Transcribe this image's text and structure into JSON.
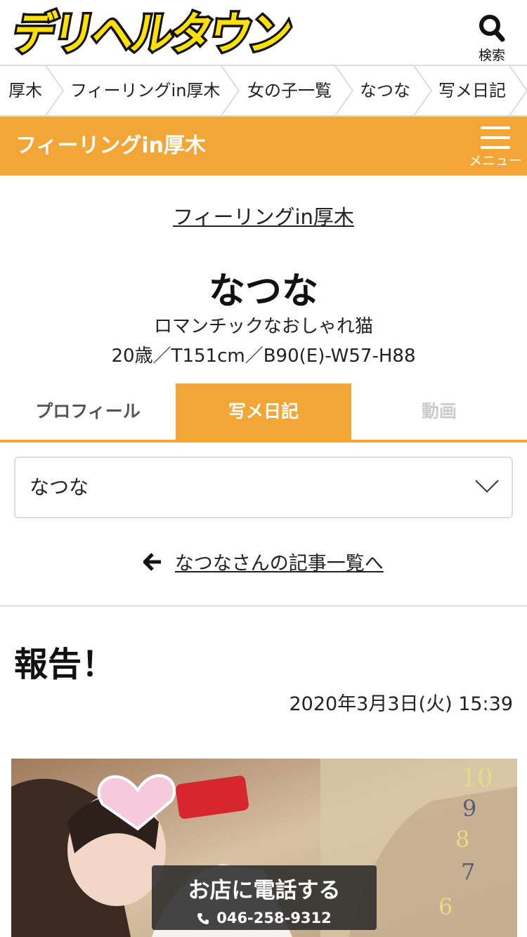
{
  "header": {
    "logo_text": "デリヘルタウン",
    "search_label": "検索"
  },
  "breadcrumb": [
    "厚木",
    "フィーリングin厚木",
    "女の子一覧",
    "なつな",
    "写メ日記"
  ],
  "shop_bar": {
    "title": "フィーリングin厚木",
    "menu_label": "メニュー"
  },
  "profile": {
    "shop_link": "フィーリングin厚木",
    "name": "なつな",
    "catchcopy": "ロマンチックなおしゃれ猫",
    "specs": "20歳／T151cm／B90(E)-W57-H88"
  },
  "tabs": {
    "profile": "プロフィール",
    "diary": "写メ日記",
    "movie": "動画"
  },
  "girl_select": {
    "value": "なつな"
  },
  "back_link": "なつなさんの記事一覧へ",
  "post": {
    "title": "報告！",
    "date": "2020年3月3日(火) 15:39"
  },
  "call": {
    "label": "お店に電話する",
    "number": "046-258-9312"
  },
  "colors": {
    "accent": "#f3a535",
    "logo_yellow": "#ffe100"
  }
}
